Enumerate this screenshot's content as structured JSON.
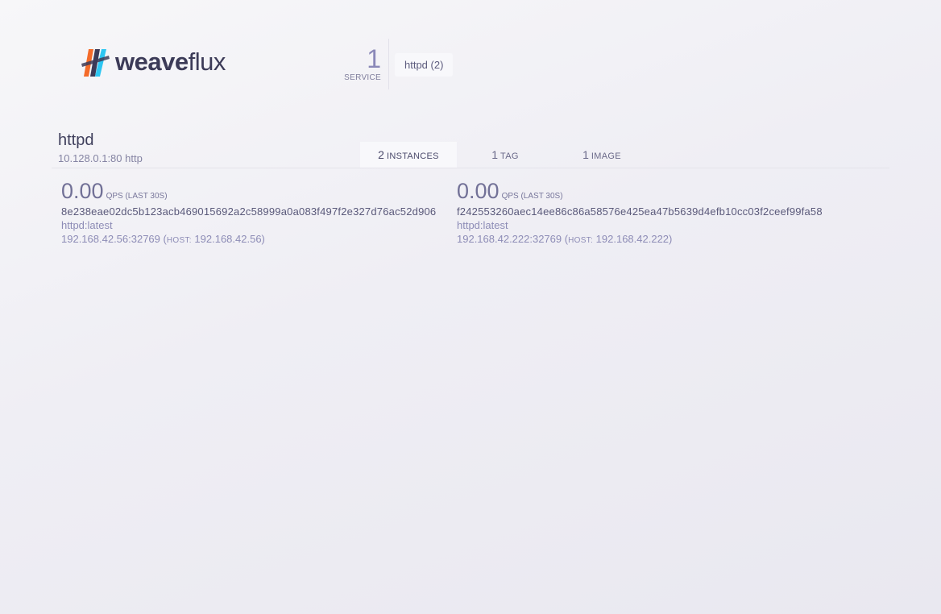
{
  "header": {
    "logo_weave": "weave",
    "logo_flux": "flux",
    "service_count": "1",
    "service_count_label": "SERVICE",
    "service_tab": "httpd (2)"
  },
  "service": {
    "name": "httpd",
    "address": "10.128.0.1:80 http"
  },
  "tabs": [
    {
      "count": "2",
      "label": "INSTANCES",
      "active": true
    },
    {
      "count": "1",
      "label": "TAG",
      "active": false
    },
    {
      "count": "1",
      "label": "IMAGE",
      "active": false
    }
  ],
  "instances": [
    {
      "qps": "0.00",
      "qps_label": "QPS (LAST 30S)",
      "id": "8e238eae02dc5b123acb469015692a2c58999a0a083f497f2e327d76ac52d906",
      "image": "httpd:latest",
      "address": "192.168.42.56:32769",
      "host_open": " (",
      "host_label": "HOST:",
      "host": " 192.168.42.56)"
    },
    {
      "qps": "0.00",
      "qps_label": "QPS (LAST 30S)",
      "id": "f242553260aec14ee86c86a58576e425ea47b5639d4efb10cc03f2ceef99fa58",
      "image": "httpd:latest",
      "address": "192.168.42.222:32769",
      "host_open": " (",
      "host_label": "HOST:",
      "host": " 192.168.42.222)"
    }
  ],
  "colors": {
    "logo_orange": "#f46b2a",
    "logo_blue": "#2dc6f2",
    "logo_dark": "#3c3b58",
    "accent": "#8a88b8"
  },
  "icons": {
    "logo": "weaveflux-logo-icon"
  }
}
